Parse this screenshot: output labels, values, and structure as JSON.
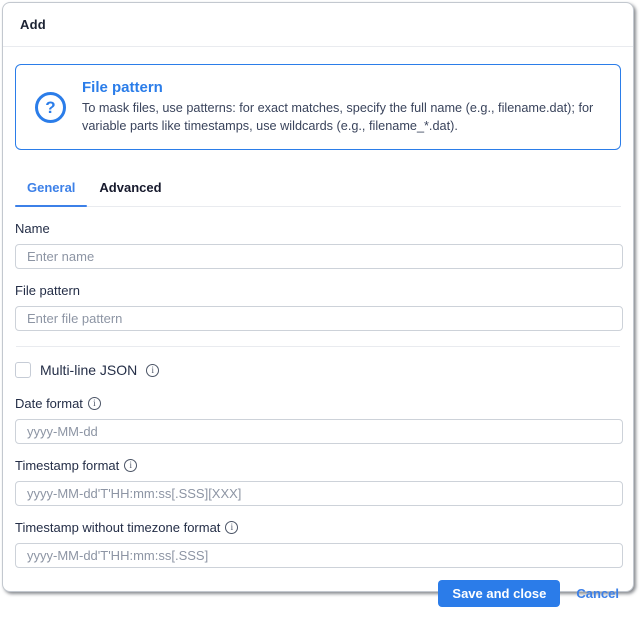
{
  "dialog": {
    "title": "Add",
    "info_box": {
      "title": "File pattern",
      "description": "To mask files, use patterns: for exact matches, specify the full name (e.g., filename.dat); for variable parts like timestamps, use wildcards (e.g., filename_*.dat)."
    },
    "tabs": [
      {
        "label": "General",
        "active": true
      },
      {
        "label": "Advanced",
        "active": false
      }
    ],
    "fields": {
      "name": {
        "label": "Name",
        "placeholder": "Enter name",
        "value": ""
      },
      "file_pattern": {
        "label": "File pattern",
        "placeholder": "Enter file pattern",
        "value": ""
      },
      "multiline_json": {
        "label": "Multi-line JSON",
        "checked": false
      },
      "date_format": {
        "label": "Date format",
        "placeholder": "yyyy-MM-dd",
        "value": ""
      },
      "timestamp_format": {
        "label": "Timestamp format",
        "placeholder": "yyyy-MM-dd'T'HH:mm:ss[.SSS][XXX]",
        "value": ""
      },
      "timestamp_without_timezone_format": {
        "label": "Timestamp without timezone format",
        "placeholder": "yyyy-MM-dd'T'HH:mm:ss[.SSS]",
        "value": ""
      }
    },
    "footer": {
      "save_label": "Save and close",
      "cancel_label": "Cancel"
    },
    "icons": {
      "help_glyph": "?",
      "info_glyph": "i"
    },
    "colors": {
      "accent": "#2b7de9",
      "label_text": "#242e47",
      "placeholder_text": "#8d95a4",
      "divider": "#e9ebef",
      "input_border": "#cdd2d9"
    }
  }
}
